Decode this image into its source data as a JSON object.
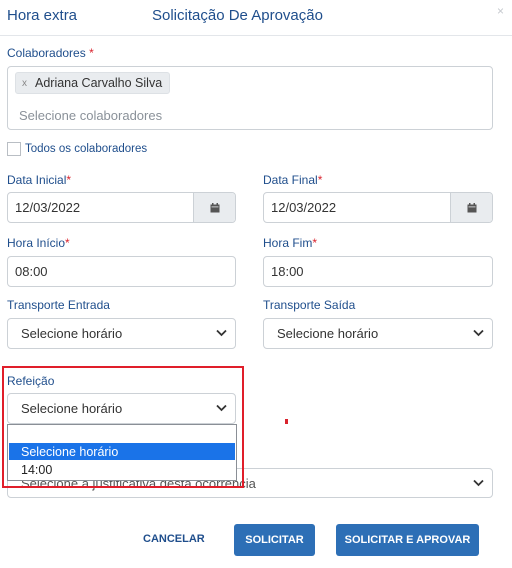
{
  "header": {
    "left_title": "Hora extra",
    "main_title": "Solicitação De Aprovação",
    "close_symbol": "×"
  },
  "colaboradores": {
    "label": "Colaboradores",
    "required_mark": "*",
    "chip_remove": "x",
    "selected": [
      "Adriana Carvalho Silva"
    ],
    "placeholder": "Selecione colaboradores"
  },
  "todos": {
    "label": "Todos os colaboradores",
    "checked": false
  },
  "data_inicial": {
    "label": "Data Inicial",
    "required_mark": "*",
    "value": "12/03/2022",
    "icon": "calendar-icon"
  },
  "data_final": {
    "label": "Data Final",
    "required_mark": "*",
    "value": "12/03/2022",
    "icon": "calendar-icon"
  },
  "hora_inicio": {
    "label": "Hora Início",
    "required_mark": "*",
    "value": "08:00"
  },
  "hora_fim": {
    "label": "Hora Fim",
    "required_mark": "*",
    "value": "18:00"
  },
  "transporte_entrada": {
    "label": "Transporte Entrada",
    "value": "Selecione horário"
  },
  "transporte_saida": {
    "label": "Transporte Saída",
    "value": "Selecione horário"
  },
  "refeicao": {
    "label": "Refeição",
    "value": "Selecione horário",
    "options": [
      "Selecione horário",
      "14:00"
    ],
    "highlighted_option": 0
  },
  "justificativa": {
    "placeholder": "Selecione a justificativa desta ocorrência"
  },
  "buttons": {
    "cancel": "CANCELAR",
    "submit": "SOLICITAR",
    "submit_approve": "SOLICITAR E APROVAR"
  },
  "colors": {
    "accent": "#1f4e8c",
    "primary_button": "#2d6fb6",
    "required": "#d9232d",
    "highlight_box": "#e01e2a",
    "selected_option": "#1a73e8"
  }
}
